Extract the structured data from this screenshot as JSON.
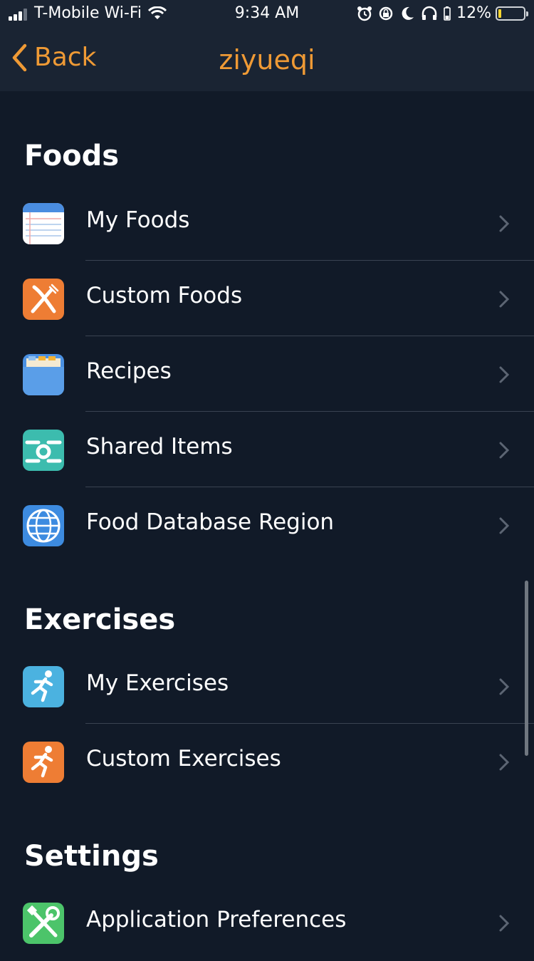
{
  "status_bar": {
    "carrier": "T-Mobile Wi-Fi",
    "time": "9:34 AM",
    "battery_percent": "12%"
  },
  "nav": {
    "back_label": "Back",
    "title": "ziyueqi"
  },
  "sections": {
    "foods": {
      "title": "Foods",
      "items": [
        {
          "label": "My Foods",
          "icon": "notepad-icon"
        },
        {
          "label": "Custom Foods",
          "icon": "fork-knife-icon"
        },
        {
          "label": "Recipes",
          "icon": "recipe-box-icon"
        },
        {
          "label": "Shared Items",
          "icon": "share-icon"
        },
        {
          "label": "Food Database Region",
          "icon": "globe-icon"
        }
      ]
    },
    "exercises": {
      "title": "Exercises",
      "items": [
        {
          "label": "My Exercises",
          "icon": "runner-icon"
        },
        {
          "label": "Custom Exercises",
          "icon": "runner-icon"
        }
      ]
    },
    "settings": {
      "title": "Settings",
      "items": [
        {
          "label": "Application Preferences",
          "icon": "wrench-screwdriver-icon"
        }
      ]
    }
  },
  "colors": {
    "background": "#111a28",
    "accent": "#ef9a35",
    "separator": "#3a4352"
  }
}
